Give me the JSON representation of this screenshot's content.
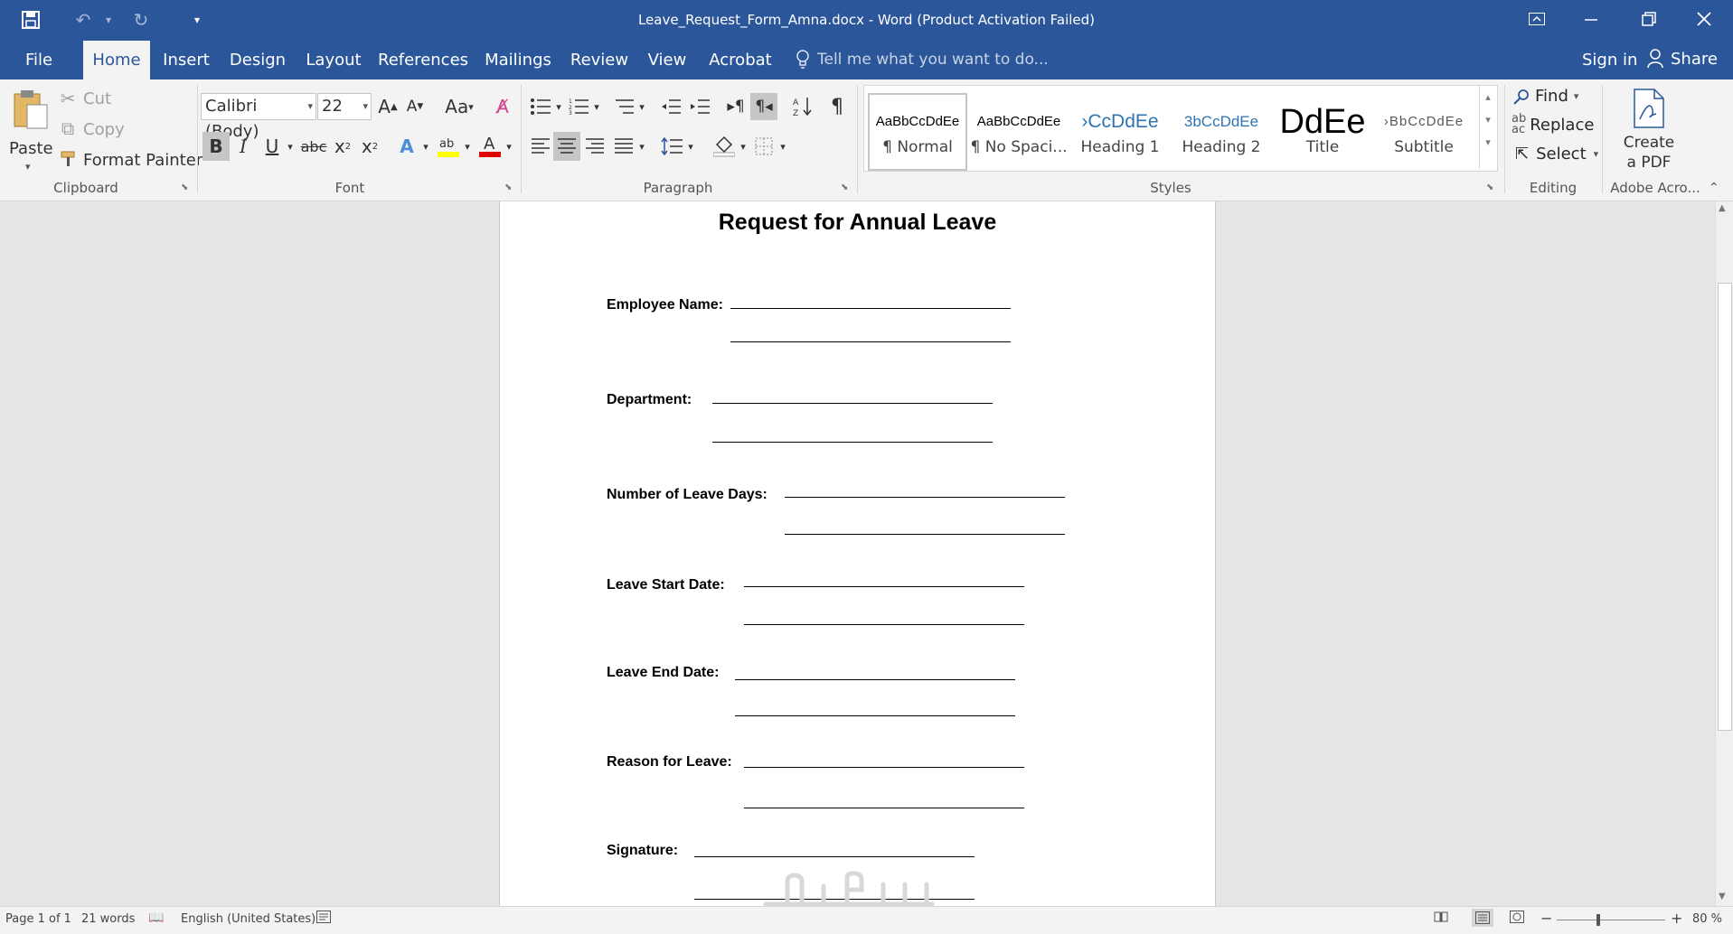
{
  "window": {
    "title": "Leave_Request_Form_Amna.docx - Word (Product Activation Failed)"
  },
  "quick_access": [
    "save-icon",
    "undo-icon",
    "redo-icon",
    "customize-qat-icon"
  ],
  "tabs": [
    "File",
    "Home",
    "Insert",
    "Design",
    "Layout",
    "References",
    "Mailings",
    "Review",
    "View",
    "Acrobat"
  ],
  "active_tab": "Home",
  "tell_me": {
    "placeholder": "Tell me what you want to do..."
  },
  "account": {
    "sign_in": "Sign in",
    "share": "Share"
  },
  "ribbon": {
    "clipboard": {
      "label": "Clipboard",
      "paste": "Paste",
      "cut": "Cut",
      "copy": "Copy",
      "format_painter": "Format Painter"
    },
    "font": {
      "label": "Font",
      "family": "Calibri (Body)",
      "size": "22"
    },
    "paragraph": {
      "label": "Paragraph"
    },
    "styles": {
      "label": "Styles",
      "items": [
        {
          "preview": "AaBbCcDdEe",
          "name": "¶ Normal"
        },
        {
          "preview": "AaBbCcDdEe",
          "name": "¶ No Spaci..."
        },
        {
          "preview": "›CcDdEe",
          "name": "Heading 1"
        },
        {
          "preview": "3bCcDdEe",
          "name": "Heading 2"
        },
        {
          "preview": "DdEe",
          "name": "Title"
        },
        {
          "preview": "›BbCcDdEe",
          "name": "Subtitle"
        }
      ]
    },
    "editing": {
      "label": "Editing",
      "find": "Find",
      "replace": "Replace",
      "select": "Select"
    },
    "adobe": {
      "label": "Adobe Acro...",
      "create_line1": "Create",
      "create_line2": "a PDF"
    }
  },
  "document": {
    "title": "Request for Annual Leave",
    "fields": [
      "Employee Name:",
      "Department:",
      "Number of Leave Days:",
      "Leave Start Date:",
      "Leave End Date:",
      "Reason for Leave:",
      "Signature:"
    ]
  },
  "status": {
    "page": "Page 1 of 1",
    "words": "21 words",
    "language": "English (United States)",
    "zoom": "80 %"
  },
  "colors": {
    "accent": "#2b579a",
    "ribbon_bg": "#f3f3f3",
    "doc_bg": "#e6e6e6"
  }
}
